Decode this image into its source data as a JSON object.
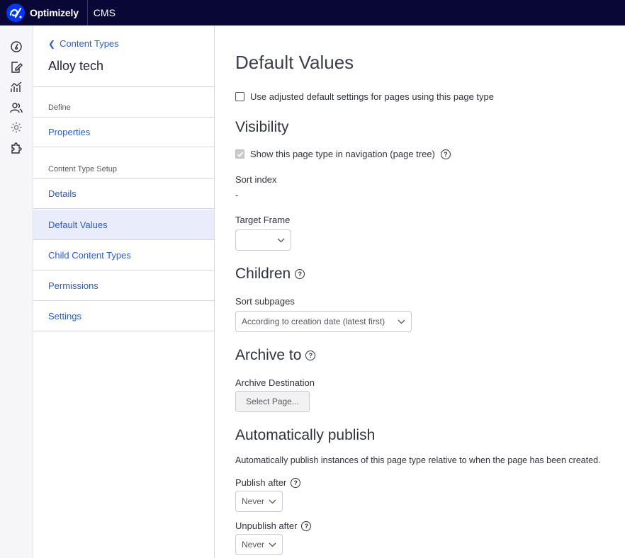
{
  "app": {
    "brand": "Optimizely",
    "product": "CMS"
  },
  "rail": {
    "icons": [
      "dashboard-icon",
      "edit-icon",
      "reports-icon",
      "users-icon",
      "settings-icon",
      "addons-icon"
    ]
  },
  "sidebar": {
    "back_label": "Content Types",
    "title": "Alloy tech",
    "group1_label": "Define",
    "group1_items": [
      "Properties"
    ],
    "group2_label": "Content Type Setup",
    "group2_items": [
      "Details",
      "Default Values",
      "Child Content Types",
      "Permissions",
      "Settings"
    ],
    "selected": "Default Values"
  },
  "main": {
    "title": "Default Values",
    "adjusted_defaults_label": "Use adjusted default settings for pages using this page type",
    "visibility": {
      "heading": "Visibility",
      "show_in_nav_label": "Show this page type in navigation (page tree)",
      "sort_index_label": "Sort index",
      "sort_index_value": "-",
      "target_frame_label": "Target Frame",
      "target_frame_value": ""
    },
    "children": {
      "heading": "Children",
      "sort_subpages_label": "Sort subpages",
      "sort_subpages_value": "According to creation date (latest first)"
    },
    "archive": {
      "heading": "Archive to",
      "destination_label": "Archive Destination",
      "select_button": "Select Page..."
    },
    "auto_publish": {
      "heading": "Automatically publish",
      "description": "Automatically publish instances of this page type relative to when the page has been created.",
      "publish_after_label": "Publish after",
      "publish_after_value": "Never",
      "unpublish_after_label": "Unpublish after",
      "unpublish_after_value": "Never"
    }
  }
}
